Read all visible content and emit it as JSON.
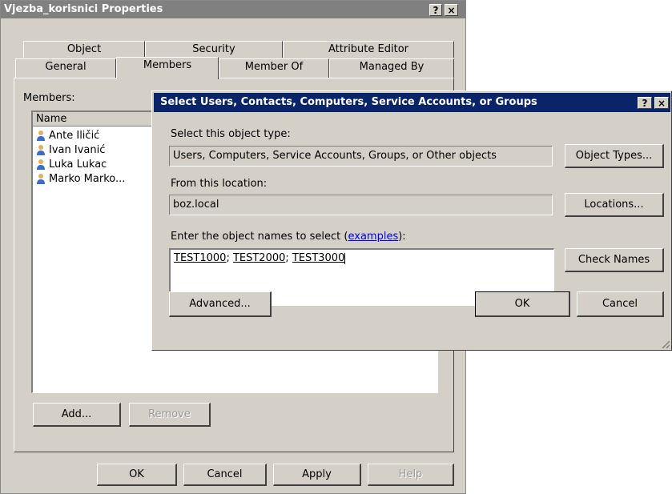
{
  "main": {
    "title": "Vjezba_korisnici Properties",
    "help_button": "?",
    "close_button": "×",
    "tabs_row1": [
      "Object",
      "Security",
      "Attribute Editor"
    ],
    "tabs_row2": [
      "General",
      "Members",
      "Member Of",
      "Managed By"
    ],
    "active_tab": "Members",
    "members_label": "Members:",
    "column_name": "Name",
    "members": [
      "Ante Iličić",
      "Ivan Ivanić",
      "Luka Lukac",
      "Marko Marko..."
    ],
    "add_button": "Add...",
    "remove_button": "Remove",
    "ok_button": "OK",
    "cancel_button": "Cancel",
    "apply_button": "Apply",
    "help_footer_button": "Help"
  },
  "dialog": {
    "title": "Select Users, Contacts, Computers, Service Accounts, or Groups",
    "help_button": "?",
    "close_button": "×",
    "object_type_label": "Select this object type:",
    "object_type_value": "Users, Computers, Service Accounts, Groups, or Other objects",
    "object_types_button": "Object Types...",
    "location_label": "From this location:",
    "location_value": "boz.local",
    "locations_button": "Locations...",
    "names_label_prefix": "Enter the object names to select (",
    "names_label_link": "examples",
    "names_label_suffix": "):",
    "names": [
      "TEST1000",
      "TEST2000",
      "TEST3000"
    ],
    "separator": "; ",
    "check_names_button": "Check Names",
    "advanced_button": "Advanced...",
    "ok_button": "OK",
    "cancel_button": "Cancel"
  },
  "colors": {
    "dialog_face": "#d4d0c8",
    "active_title": "#0a246a",
    "inactive_title": "#808080",
    "link": "#0000ee"
  },
  "icons": {
    "member": "user-icon",
    "help": "question-mark",
    "close": "x-mark"
  }
}
